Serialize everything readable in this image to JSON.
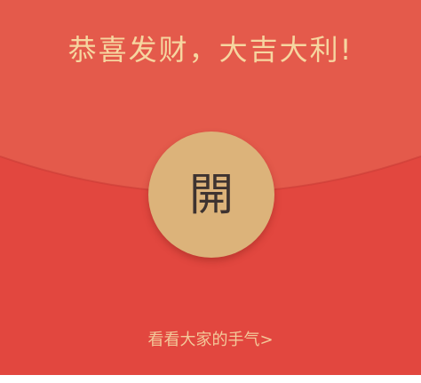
{
  "envelope": {
    "greeting": "恭喜发财，大吉大利!",
    "open_label": "開",
    "see_luck_label": "看看大家的手气>"
  },
  "colors": {
    "flap": "#e45a4b",
    "body": "#e2473f",
    "text_gold": "#f6d6a0",
    "button_gold": "#dcb37a",
    "open_char": "#3e3330"
  }
}
